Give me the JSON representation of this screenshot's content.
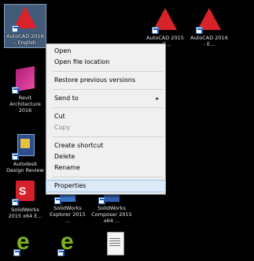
{
  "desktop": {
    "icons": [
      {
        "label": "AutoCAD 2016 - English",
        "kind": "autocad"
      },
      {
        "label": "Revit Architecture 2016",
        "kind": "revit"
      },
      {
        "label": "Autodesk Design Review",
        "kind": "design-review"
      },
      {
        "label": "SolidWorks 2015 x64 E...",
        "kind": "solidworks"
      },
      {
        "label": "SolidWorks Explorer 2015 ...",
        "kind": "solidworks-explorer"
      },
      {
        "label": "SolidWorks Composer 2015 x64 ...",
        "kind": "solidworks-composer"
      },
      {
        "label": "AutoCAD 2015 - E...",
        "kind": "autocad"
      },
      {
        "label": "AutoCAD 2016 - E...",
        "kind": "autocad"
      },
      {
        "label": "",
        "kind": "ie"
      },
      {
        "label": "",
        "kind": "ie"
      },
      {
        "label": "",
        "kind": "document"
      }
    ]
  },
  "context_menu": {
    "items": [
      {
        "label": "Open",
        "state": "normal"
      },
      {
        "label": "Open file location",
        "state": "normal"
      },
      {
        "label": "Restore previous versions",
        "state": "normal"
      },
      {
        "label": "Send to",
        "state": "submenu"
      },
      {
        "label": "Cut",
        "state": "normal"
      },
      {
        "label": "Copy",
        "state": "dim"
      },
      {
        "label": "Create shortcut",
        "state": "normal"
      },
      {
        "label": "Delete",
        "state": "normal"
      },
      {
        "label": "Rename",
        "state": "normal"
      },
      {
        "label": "Properties",
        "state": "highlight"
      }
    ],
    "submenu_arrow": "▸"
  }
}
